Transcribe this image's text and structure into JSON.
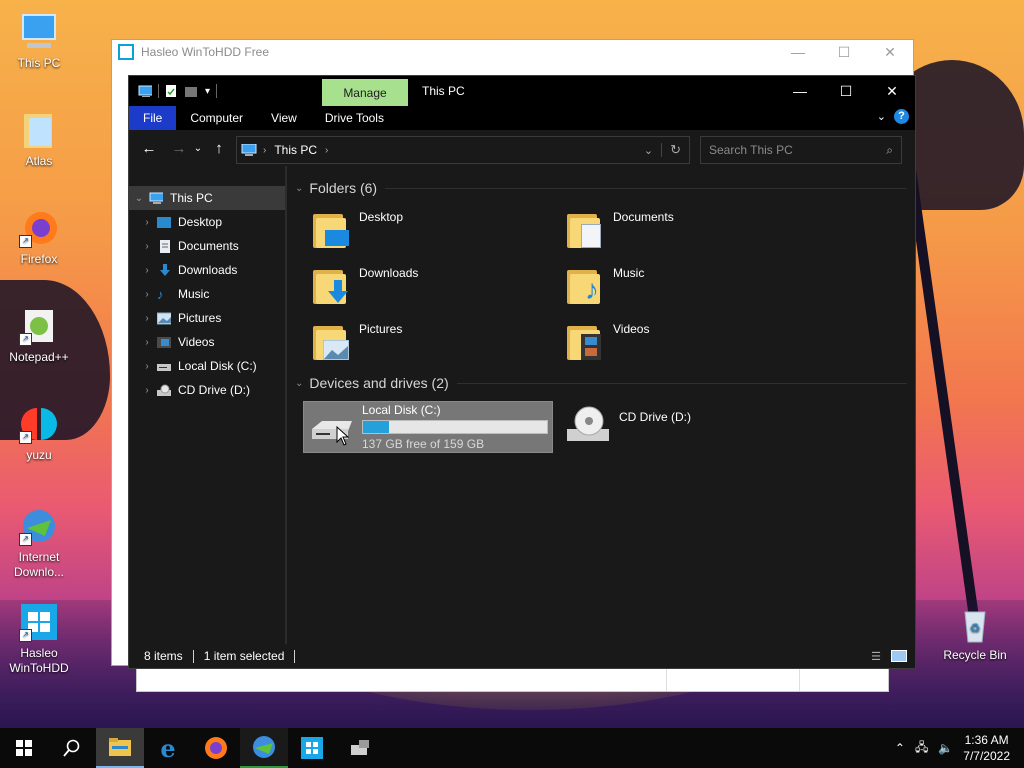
{
  "desktop": {
    "icons": [
      {
        "label": "This PC"
      },
      {
        "label": "Atlas"
      },
      {
        "label": "Firefox"
      },
      {
        "label": "Notepad++"
      },
      {
        "label": "yuzu"
      },
      {
        "label": "Internet Downlo..."
      },
      {
        "label": "Hasleo WinToHDD"
      },
      {
        "label": "Recycle Bin"
      }
    ]
  },
  "hasleo": {
    "title": "Hasleo WinToHDD Free"
  },
  "explorer": {
    "title": "This PC",
    "manage_tab": "Manage",
    "ribbon_tabs": [
      "File",
      "Computer",
      "View",
      "Drive Tools"
    ],
    "address": "This PC",
    "search_placeholder": "Search This PC",
    "nav": [
      {
        "label": "This PC"
      },
      {
        "label": "Desktop"
      },
      {
        "label": "Documents"
      },
      {
        "label": "Downloads"
      },
      {
        "label": "Music"
      },
      {
        "label": "Pictures"
      },
      {
        "label": "Videos"
      },
      {
        "label": "Local Disk (C:)"
      },
      {
        "label": "CD Drive (D:)"
      }
    ],
    "folders_header": "Folders (6)",
    "folders": [
      {
        "label": "Desktop"
      },
      {
        "label": "Documents"
      },
      {
        "label": "Downloads"
      },
      {
        "label": "Music"
      },
      {
        "label": "Pictures"
      },
      {
        "label": "Videos"
      }
    ],
    "devices_header": "Devices and drives (2)",
    "drives": [
      {
        "label": "Local Disk (C:)",
        "free": "137 GB free of 159 GB",
        "used_fraction": 0.14
      },
      {
        "label": "CD Drive (D:)"
      }
    ],
    "status": {
      "items": "8 items",
      "selected": "1 item selected"
    }
  },
  "taskbar": {
    "time": "1:36 AM",
    "date": "7/7/2022"
  },
  "colors": {
    "accent": "#1b3bc8",
    "manage": "#a8e18e",
    "drive_bar": "#26a0da"
  }
}
